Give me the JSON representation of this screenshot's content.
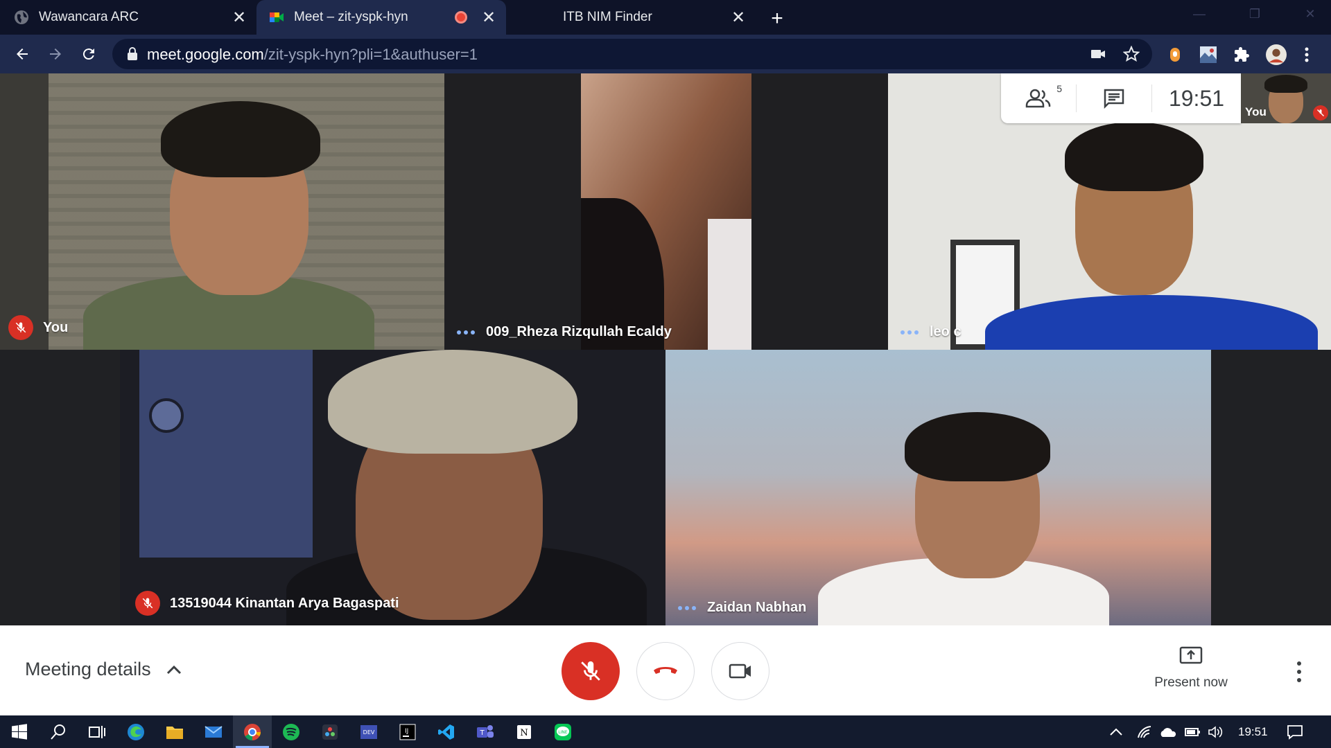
{
  "browser": {
    "tabs": [
      {
        "title": "Wawancara ARC",
        "favicon": "globe-icon",
        "active": false
      },
      {
        "title": "Meet – zit-yspk-hyn",
        "favicon": "google-meet-icon",
        "active": true,
        "recording": true
      },
      {
        "title": "ITB NIM Finder",
        "favicon": "",
        "active": false
      }
    ],
    "url_host": "meet.google.com",
    "url_path": "/zit-yspk-hyn?pli=1&authuser=1"
  },
  "participants": [
    {
      "name": "You",
      "muted": true,
      "tile_bg": "#6b6a60"
    },
    {
      "name": "009_Rheza Rizqullah Ecaldy",
      "muted": false,
      "tile_bg": "#1f1f22"
    },
    {
      "name": "leo c",
      "muted": false,
      "tile_bg": "#e4e4e0"
    },
    {
      "name": "13519044 Kinantan Arya Bagaspati",
      "muted": true,
      "tile_bg": "#1c1d24"
    },
    {
      "name": "Zaidan Nabhan",
      "muted": false,
      "tile_bg": "#9fb3c6"
    }
  ],
  "info_panel": {
    "people_count": "5",
    "clock": "19:51",
    "self_label": "You"
  },
  "controls": {
    "meeting_details": "Meeting details",
    "present_now": "Present now",
    "mic_state": "off",
    "colors": {
      "danger": "#d93025",
      "text": "#3c4043"
    }
  },
  "taskbar": {
    "clock": "19:51",
    "apps": [
      "start-icon",
      "search-icon",
      "task-view-icon",
      "edge-icon",
      "file-explorer-icon",
      "mail-icon",
      "chrome-icon",
      "spotify-icon",
      "davinci-icon",
      "dev-icon",
      "intellij-icon",
      "vscode-icon",
      "teams-icon",
      "notion-icon",
      "line-icon"
    ]
  }
}
